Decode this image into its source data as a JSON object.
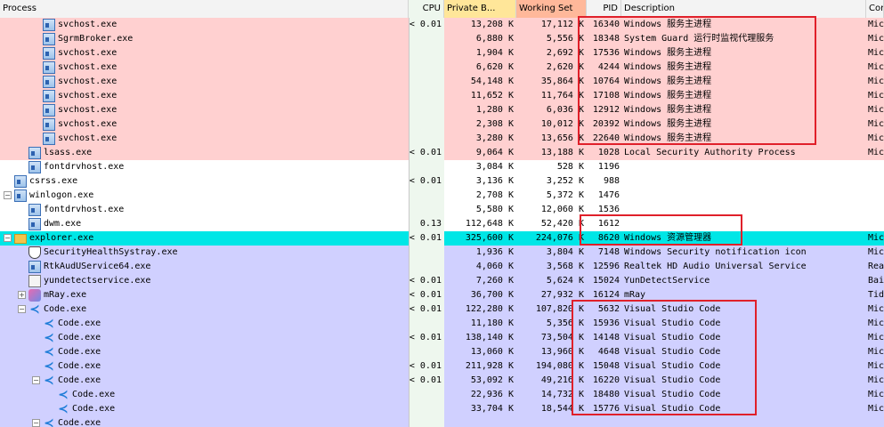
{
  "columns": {
    "process": "Process",
    "cpu": "CPU",
    "private_bytes": "Private B...",
    "working_set": "Working Set",
    "pid": "PID",
    "description": "Description",
    "company": "Com"
  },
  "colors": {
    "service_pink": "#ffd0d0",
    "own_process_blue": "#d0d0ff",
    "selected_cyan": "#00e6e6",
    "cpu_column": "#eef7ee",
    "private_header": "#ffe699",
    "working_header": "#ffb89a",
    "highlight_box": "#e0202a"
  },
  "rows": [
    {
      "name": "svchost.exe",
      "cpu": "< 0.01",
      "priv": "13,208 K",
      "ws": "17,112 K",
      "pid": "16340",
      "desc": "Windows 服务主进程",
      "comp": "Micr"
    },
    {
      "name": "SgrmBroker.exe",
      "cpu": "",
      "priv": "6,880 K",
      "ws": "5,556 K",
      "pid": "18348",
      "desc": "System Guard 运行时监视代理服务",
      "comp": "Micr"
    },
    {
      "name": "svchost.exe",
      "cpu": "",
      "priv": "1,904 K",
      "ws": "2,692 K",
      "pid": "17536",
      "desc": "Windows 服务主进程",
      "comp": "Micr"
    },
    {
      "name": "svchost.exe",
      "cpu": "",
      "priv": "6,620 K",
      "ws": "2,620 K",
      "pid": "4244",
      "desc": "Windows 服务主进程",
      "comp": "Micr"
    },
    {
      "name": "svchost.exe",
      "cpu": "",
      "priv": "54,148 K",
      "ws": "35,864 K",
      "pid": "10764",
      "desc": "Windows 服务主进程",
      "comp": "Micr"
    },
    {
      "name": "svchost.exe",
      "cpu": "",
      "priv": "11,652 K",
      "ws": "11,764 K",
      "pid": "17108",
      "desc": "Windows 服务主进程",
      "comp": "Micr"
    },
    {
      "name": "svchost.exe",
      "cpu": "",
      "priv": "1,280 K",
      "ws": "6,036 K",
      "pid": "12912",
      "desc": "Windows 服务主进程",
      "comp": "Micr"
    },
    {
      "name": "svchost.exe",
      "cpu": "",
      "priv": "2,308 K",
      "ws": "10,012 K",
      "pid": "20392",
      "desc": "Windows 服务主进程",
      "comp": "Micr"
    },
    {
      "name": "svchost.exe",
      "cpu": "",
      "priv": "3,280 K",
      "ws": "13,656 K",
      "pid": "22640",
      "desc": "Windows 服务主进程",
      "comp": "Micr"
    },
    {
      "name": "lsass.exe",
      "cpu": "< 0.01",
      "priv": "9,064 K",
      "ws": "13,188 K",
      "pid": "1028",
      "desc": "Local Security Authority Process",
      "comp": "Micr"
    },
    {
      "name": "fontdrvhost.exe",
      "cpu": "",
      "priv": "3,084 K",
      "ws": "528 K",
      "pid": "1196",
      "desc": "",
      "comp": ""
    },
    {
      "name": "csrss.exe",
      "cpu": "< 0.01",
      "priv": "3,136 K",
      "ws": "3,252 K",
      "pid": "988",
      "desc": "",
      "comp": ""
    },
    {
      "name": "winlogon.exe",
      "cpu": "",
      "priv": "2,708 K",
      "ws": "5,372 K",
      "pid": "1476",
      "desc": "",
      "comp": ""
    },
    {
      "name": "fontdrvhost.exe",
      "cpu": "",
      "priv": "5,580 K",
      "ws": "12,060 K",
      "pid": "1536",
      "desc": "",
      "comp": ""
    },
    {
      "name": "dwm.exe",
      "cpu": "0.13",
      "priv": "112,648 K",
      "ws": "52,420 K",
      "pid": "1612",
      "desc": "",
      "comp": ""
    },
    {
      "name": "explorer.exe",
      "cpu": "< 0.01",
      "priv": "325,600 K",
      "ws": "224,076 K",
      "pid": "8620",
      "desc": "Windows 资源管理器",
      "comp": "Micr"
    },
    {
      "name": "SecurityHealthSystray.exe",
      "cpu": "",
      "priv": "1,936 K",
      "ws": "3,804 K",
      "pid": "7148",
      "desc": "Windows Security notification icon",
      "comp": "Micr"
    },
    {
      "name": "RtkAudUService64.exe",
      "cpu": "",
      "priv": "4,060 K",
      "ws": "3,568 K",
      "pid": "12596",
      "desc": "Realtek HD Audio Universal Service",
      "comp": "Real"
    },
    {
      "name": "yundetectservice.exe",
      "cpu": "< 0.01",
      "priv": "7,260 K",
      "ws": "5,624 K",
      "pid": "15024",
      "desc": "YunDetectService",
      "comp": "Baid"
    },
    {
      "name": "mRay.exe",
      "cpu": "< 0.01",
      "priv": "36,700 K",
      "ws": "27,932 K",
      "pid": "16124",
      "desc": "mRay",
      "comp": "Tids"
    },
    {
      "name": "Code.exe",
      "cpu": "< 0.01",
      "priv": "122,280 K",
      "ws": "107,820 K",
      "pid": "5632",
      "desc": "Visual Studio Code",
      "comp": "Micr"
    },
    {
      "name": "Code.exe",
      "cpu": "",
      "priv": "11,180 K",
      "ws": "5,356 K",
      "pid": "15936",
      "desc": "Visual Studio Code",
      "comp": "Micr"
    },
    {
      "name": "Code.exe",
      "cpu": "< 0.01",
      "priv": "138,140 K",
      "ws": "73,504 K",
      "pid": "14148",
      "desc": "Visual Studio Code",
      "comp": "Micr"
    },
    {
      "name": "Code.exe",
      "cpu": "",
      "priv": "13,060 K",
      "ws": "13,960 K",
      "pid": "4648",
      "desc": "Visual Studio Code",
      "comp": "Micr"
    },
    {
      "name": "Code.exe",
      "cpu": "< 0.01",
      "priv": "211,928 K",
      "ws": "194,080 K",
      "pid": "15048",
      "desc": "Visual Studio Code",
      "comp": "Micr"
    },
    {
      "name": "Code.exe",
      "cpu": "< 0.01",
      "priv": "53,092 K",
      "ws": "49,216 K",
      "pid": "16220",
      "desc": "Visual Studio Code",
      "comp": "Micr"
    },
    {
      "name": "Code.exe",
      "cpu": "",
      "priv": "22,936 K",
      "ws": "14,732 K",
      "pid": "18480",
      "desc": "Visual Studio Code",
      "comp": "Micr"
    },
    {
      "name": "Code.exe",
      "cpu": "",
      "priv": "33,704 K",
      "ws": "18,544 K",
      "pid": "15776",
      "desc": "Visual Studio Code",
      "comp": "Micr"
    },
    {
      "name": "Code.exe",
      "cpu": "",
      "priv": "",
      "ws": "",
      "pid": "",
      "desc": "",
      "comp": ""
    }
  ]
}
